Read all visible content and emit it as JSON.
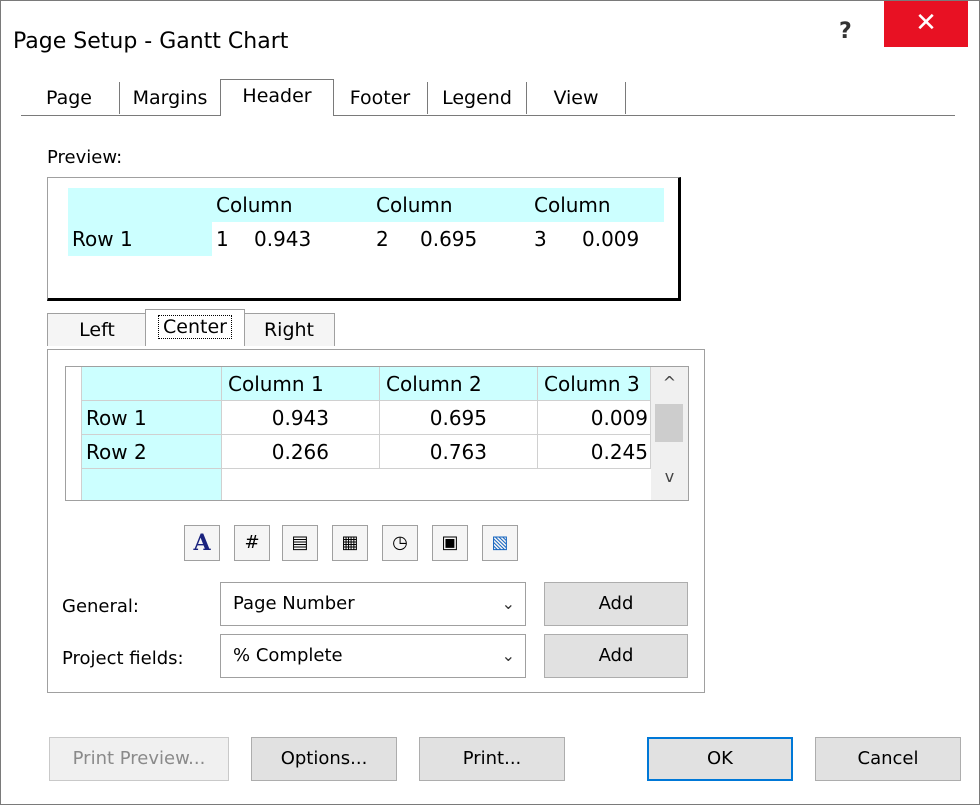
{
  "window": {
    "title": "Page Setup - Gantt Chart",
    "help": "?",
    "close": "✕"
  },
  "tabs": [
    "Page",
    "Margins",
    "Header",
    "Footer",
    "Legend",
    "View"
  ],
  "preview": {
    "label": "Preview:",
    "headers": [
      "Column 1",
      "Column 2",
      "Column 3"
    ],
    "row_label": "Row 1",
    "values": [
      "0.943",
      "0.695",
      "0.009"
    ],
    "highlight": "#ccffff"
  },
  "subtabs": [
    "Left",
    "Center",
    "Right"
  ],
  "grid": {
    "headers": [
      "Column 1",
      "Column 2",
      "Column 3"
    ],
    "rows": [
      {
        "label": "Row 1",
        "values": [
          "0.943",
          "0.695",
          "0.009"
        ]
      },
      {
        "label": "Row 2",
        "values": [
          "0.266",
          "0.763",
          "0.245"
        ]
      }
    ],
    "scroll_up": "^",
    "scroll_down": "v"
  },
  "icons": [
    "font-icon",
    "page-number-icon",
    "total-pages-icon",
    "date-icon",
    "time-icon",
    "file-name-icon",
    "picture-icon"
  ],
  "general": {
    "label": "General:",
    "value": "Page Number",
    "add": "Add"
  },
  "project_fields": {
    "label": "Project fields:",
    "value": "% Complete",
    "add": "Add"
  },
  "buttons": {
    "print_preview": "Print Preview...",
    "options": "Options...",
    "print": "Print...",
    "ok": "OK",
    "cancel": "Cancel"
  },
  "colors": {
    "close_red": "#e81123",
    "focus_blue": "#0078d7",
    "cell_cyan": "#ccffff"
  }
}
